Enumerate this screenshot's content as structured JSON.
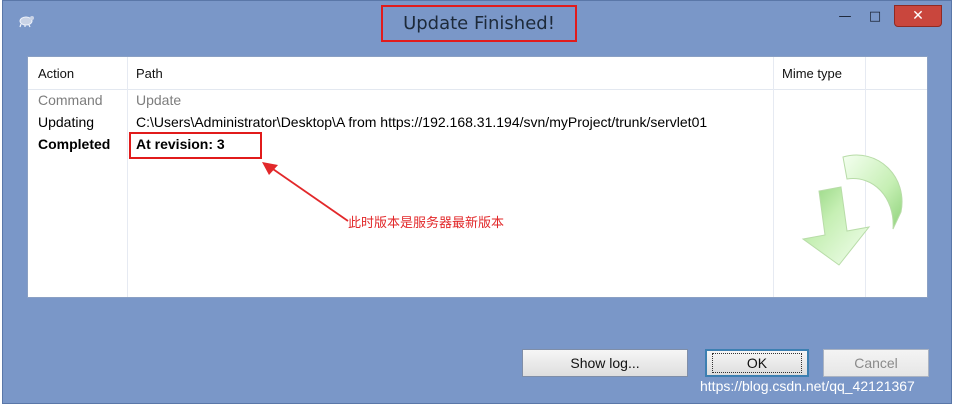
{
  "window": {
    "title": "Update Finished!",
    "minimize_label": "—",
    "maximize_label": "□",
    "close_label": "✕"
  },
  "table": {
    "columns": [
      "Action",
      "Path",
      "Mime type"
    ],
    "rows": [
      {
        "action": "Command",
        "path": "Update"
      },
      {
        "action": "Updating",
        "path": "C:\\Users\\Administrator\\Desktop\\A from https://192.168.31.194/svn/myProject/trunk/servlet01"
      },
      {
        "action": "Completed",
        "path": "At revision: 3"
      }
    ]
  },
  "annotation": {
    "text": "此时版本是服务器最新版本",
    "color": "#e2282a"
  },
  "buttons": {
    "show_log": "Show log...",
    "ok": "OK",
    "cancel": "Cancel"
  },
  "watermark": "https://blog.csdn.net/qq_42121367",
  "colors": {
    "window_bg": "#7a97c8",
    "highlight_box": "#e11b1b",
    "close_button": "#c9463d"
  },
  "icons": {
    "app": "tortoise-icon",
    "status_graphic": "green-update-arrow-icon"
  }
}
